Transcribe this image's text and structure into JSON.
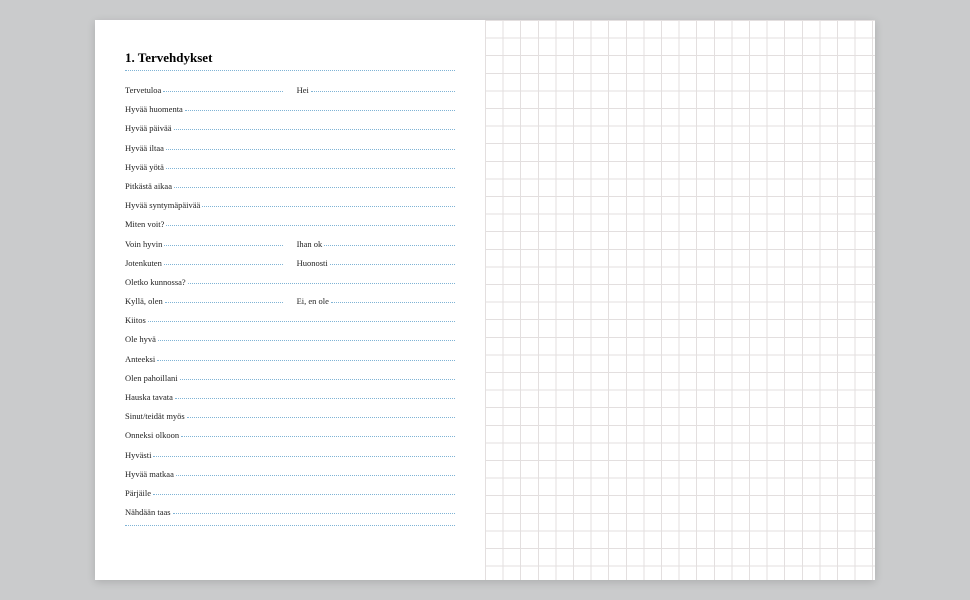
{
  "title": "1. Tervehdykset",
  "rows": [
    {
      "type": "pair",
      "left": "Tervetuloa",
      "right": "Hei"
    },
    {
      "type": "single",
      "text": "Hyvää huomenta"
    },
    {
      "type": "single",
      "text": "Hyvää päivää"
    },
    {
      "type": "single",
      "text": "Hyvää iltaa"
    },
    {
      "type": "single",
      "text": "Hyvää yötä"
    },
    {
      "type": "single",
      "text": "Pitkästä aikaa"
    },
    {
      "type": "single",
      "text": "Hyvää syntymäpäivää"
    },
    {
      "type": "single",
      "text": "Miten voit?"
    },
    {
      "type": "pair",
      "left": "Voin hyvin",
      "right": "Ihan ok"
    },
    {
      "type": "pair",
      "left": "Jotenkuten",
      "right": "Huonosti"
    },
    {
      "type": "single",
      "text": "Oletko kunnossa?"
    },
    {
      "type": "pair",
      "left": "Kyllä, olen",
      "right": "Ei, en ole"
    },
    {
      "type": "single",
      "text": "Kiitos"
    },
    {
      "type": "single",
      "text": "Ole hyvä"
    },
    {
      "type": "single",
      "text": "Anteeksi"
    },
    {
      "type": "single",
      "text": "Olen pahoillani"
    },
    {
      "type": "single",
      "text": "Hauska tavata"
    },
    {
      "type": "single",
      "text": "Sinut/teidät myös"
    },
    {
      "type": "single",
      "text": "Onneksi olkoon"
    },
    {
      "type": "single",
      "text": "Hyvästi"
    },
    {
      "type": "single",
      "text": "Hyvää matkaa"
    },
    {
      "type": "single",
      "text": "Pärjäile"
    },
    {
      "type": "single",
      "text": "Nähdään taas"
    },
    {
      "type": "empty"
    }
  ]
}
